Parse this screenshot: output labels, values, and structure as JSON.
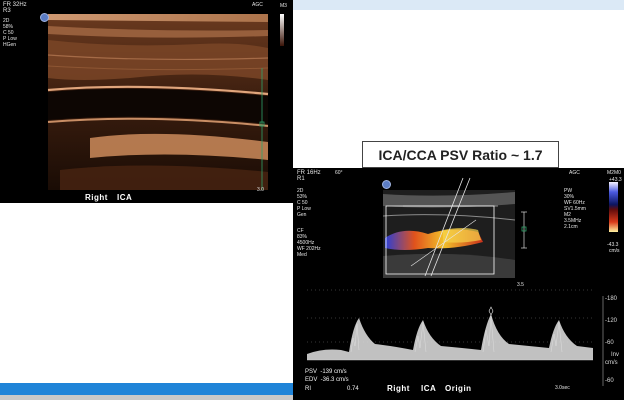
{
  "top_panel": {
    "fr": "FR 32Hz",
    "r": "R3",
    "agc": "AGC",
    "m": "M3",
    "params": [
      "2D",
      "58%",
      "C 50",
      "P Low",
      "HGen"
    ],
    "label_left": "Right",
    "label_right": "ICA",
    "depth": "3.0"
  },
  "title": {
    "text": "ICA/CCA PSV Ratio ~ 1.7"
  },
  "doppler_panel": {
    "fr": "FR 16Hz",
    "r": "R1",
    "angle": "60°",
    "agc": "AGC",
    "m2m0": "M2M0",
    "scale_top": "+43.3",
    "scale_bottom": "-43.3",
    "scale_unit": "cm/s",
    "params_2d": [
      "2D",
      "53%",
      "C 50",
      "P Low",
      "Gen"
    ],
    "params_cf": [
      "CF",
      "83%",
      "4500Hz",
      "WF 202Hz",
      "Med"
    ],
    "params_pw": [
      "PW",
      "30%",
      "WF 60Hz",
      "SV1.5mm",
      "M2",
      "3.5MHz",
      "2.1cm"
    ],
    "depth": "3.5",
    "ticks": [
      "-180",
      "-120",
      "-60",
      "-60"
    ],
    "inv": "Inv",
    "inv_unit": "cm/s",
    "psv": "PSV  -139 cm/s",
    "edv": "EDV  -36.3 cm/s",
    "ri_label": "RI",
    "ri_value": "0.74",
    "label": [
      "Right",
      "ICA",
      "Origin"
    ],
    "time": "3.0sec"
  },
  "colors": {
    "accent_blue": "#1f84d8",
    "sky_band": "#dbe9f6"
  }
}
